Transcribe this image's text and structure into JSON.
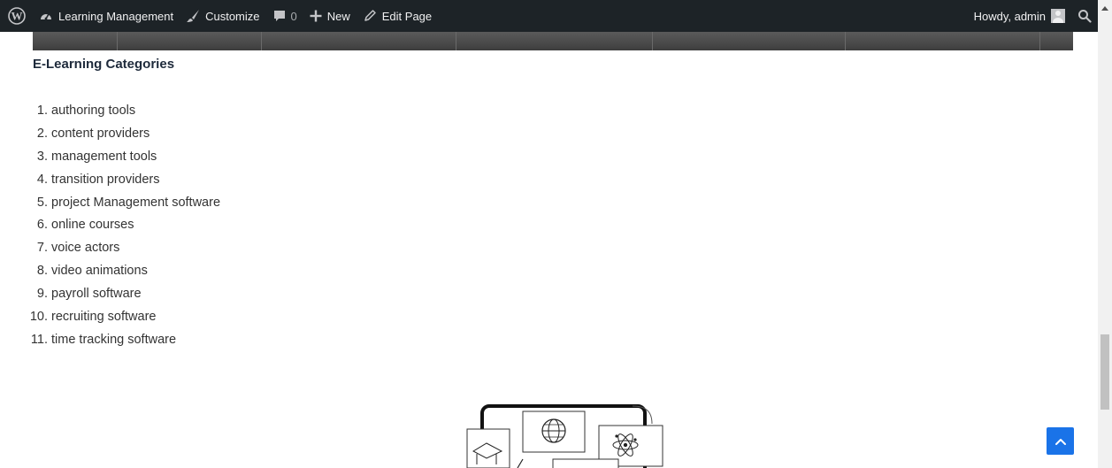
{
  "adminbar": {
    "site_name": "Learning Management",
    "customize_label": "Customize",
    "comments_count": "0",
    "new_label": "New",
    "edit_page_label": "Edit Page",
    "howdy_label": "Howdy, admin"
  },
  "content": {
    "heading": "E-Learning Categories",
    "categories": [
      {
        "num": "1.",
        "label": "authoring tools"
      },
      {
        "num": "2.",
        "label": "content providers"
      },
      {
        "num": "3.",
        "label": "management tools"
      },
      {
        "num": "4.",
        "label": "transition providers"
      },
      {
        "num": "5.",
        "label": "project Management software"
      },
      {
        "num": "6.",
        "label": "online courses"
      },
      {
        "num": "7.",
        "label": "voice actors"
      },
      {
        "num": "8.",
        "label": "video animations"
      },
      {
        "num": "9.",
        "label": "payroll software"
      },
      {
        "num": "10.",
        "label": "recruiting software"
      },
      {
        "num": "11.",
        "label": "time tracking software"
      }
    ]
  },
  "icons": {
    "wp": "wordpress-logo-icon",
    "dashboard": "dashboard-icon",
    "customize": "paintbrush-icon",
    "comments": "comment-bubble-icon",
    "new": "plus-icon",
    "edit": "pencil-icon",
    "search": "search-icon",
    "to_top": "chevron-up-icon"
  },
  "colors": {
    "adminbar_bg": "#1d2327",
    "heading": "#1e2a3b",
    "body_text": "#333333",
    "to_top_bg": "#1a73e8"
  }
}
